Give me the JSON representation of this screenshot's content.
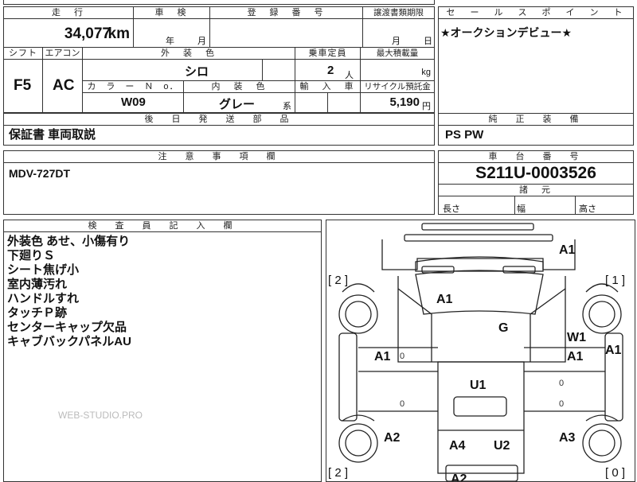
{
  "sheet": {
    "mileage_label": "走　行",
    "mileage_value": "34,077",
    "mileage_unit": "km",
    "inspection_label": "車　検",
    "inspection_year": "年",
    "inspection_month": "月",
    "registration_label": "登　録　番　号",
    "transfer_label": "譲渡書類期限",
    "transfer_month": "月",
    "transfer_day": "日",
    "shift_label": "シフト",
    "shift_value": "F5",
    "ac_label": "エアコン",
    "ac_value": "AC",
    "exterior_label": "外　装　色",
    "exterior_value": "シロ",
    "capacity_label": "乗車定員",
    "capacity_value": "2",
    "capacity_unit": "人",
    "load_label": "最大積載量",
    "load_unit": "kg",
    "color_no_label": "カ　ラ　ー　Ｎ　o．",
    "color_no_value": "W09",
    "interior_label": "内　装　色",
    "interior_value": "グレー",
    "interior_suffix": "系",
    "import_label": "輸　入　車",
    "recycle_label": "リサイクル預託金",
    "recycle_value": "5,190",
    "recycle_unit": "円",
    "later_parts_label": "後　日　発　送　部　品",
    "later_parts_value": "保証書 車両取説",
    "caution_label": "注　意　事　項　欄",
    "caution_value": "MDV-727DT",
    "inspector_label": "検　査　員　記　入　欄",
    "inspector_notes": [
      "外装色 あせ、小傷有り",
      "下廻りＳ",
      "シート焦げ小",
      "室内薄汚れ",
      "ハンドルすれ",
      "タッチＰ跡",
      "センターキャップ欠品",
      "キャブバックパネルAU"
    ],
    "watermark": "WEB-STUDIO.PRO"
  },
  "right_panel": {
    "sales_point_label": "セ　ー　ル　ス　ポ　イ　ン　ト",
    "sales_point_value": "★オークションデビュー★",
    "equipment_label": "純　正　装　備",
    "equipment_value": "PS PW",
    "chassis_label": "車　台　番　号",
    "chassis_value": "S211U-0003526",
    "dims_label": "諸　元",
    "length_label": "長さ",
    "width_label": "幅",
    "height_label": "高さ"
  },
  "diagram": {
    "marks": [
      "A1",
      "A1",
      "G",
      "W1",
      "A1",
      "A1",
      "A1",
      "U1",
      "A2",
      "A4",
      "U2",
      "A3",
      "A2"
    ],
    "tires_top": [
      "[ 2 ]",
      "[ 1 ]"
    ],
    "tires_bottom": [
      "[ 2 ]",
      "[ 0 ]"
    ],
    "zeros": [
      "0",
      "0",
      "0",
      "0"
    ]
  }
}
